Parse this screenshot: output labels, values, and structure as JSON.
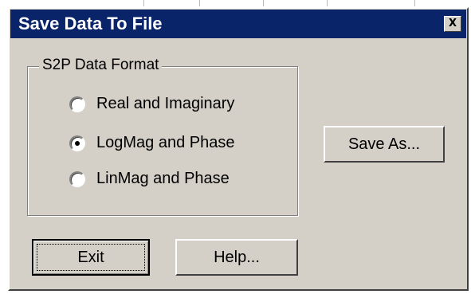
{
  "window": {
    "title": "Save Data To File",
    "close_glyph": "X"
  },
  "format_group": {
    "legend": "S2P Data Format",
    "options": [
      {
        "label": "Real and Imaginary",
        "selected": false
      },
      {
        "label": "LogMag and Phase",
        "selected": true
      },
      {
        "label": "LinMag and Phase",
        "selected": false
      }
    ]
  },
  "buttons": {
    "save_as": "Save As...",
    "exit": "Exit",
    "help": "Help..."
  },
  "colors": {
    "titlebar": "#0a246a",
    "face": "#d4d0c8"
  }
}
